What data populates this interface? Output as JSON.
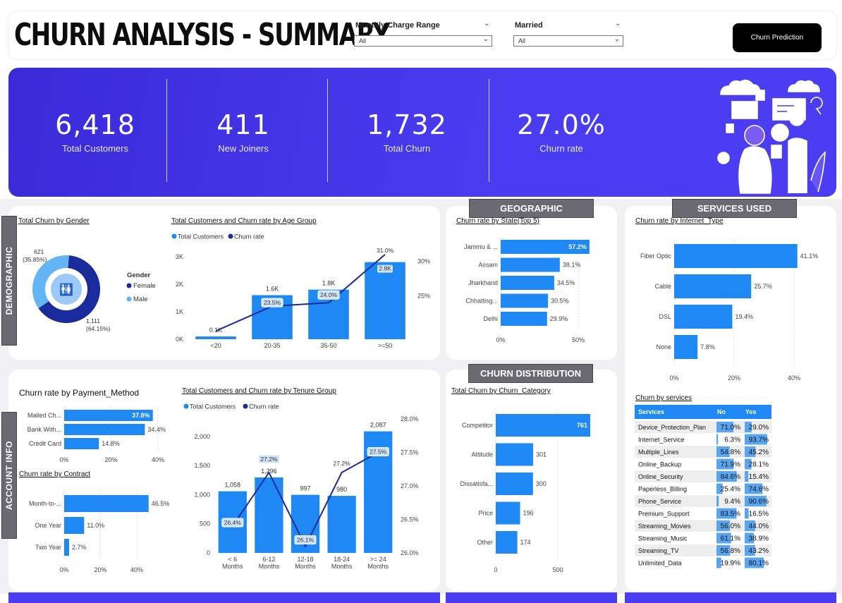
{
  "header": {
    "title": "CHURN ANALYSIS - SUMMARY",
    "slicers": [
      {
        "label": "Monthly Charge Range",
        "value": "All"
      },
      {
        "label": "Married",
        "value": "All"
      }
    ],
    "button": "Churn Prediction"
  },
  "kpis": [
    {
      "value": "6,418",
      "label": "Total Customers"
    },
    {
      "value": "411",
      "label": "New Joiners"
    },
    {
      "value": "1,732",
      "label": "Total Churn"
    },
    {
      "value": "27.0%",
      "label": "Churn rate"
    }
  ],
  "sections": {
    "demographic": "DEMOGRAPHIC",
    "account_info": "ACCOUNT INFO",
    "geographic": "GEOGRAPHIC",
    "services_used": "SERVICES USED",
    "churn_distribution": "CHURN DISTRIBUTION"
  },
  "colors": {
    "primary": "#1e88f5",
    "dark": "#1a2b9c",
    "light": "#64b5f6",
    "band": "#4a3cf0"
  },
  "chart_data": [
    {
      "id": "gender",
      "type": "pie",
      "title": "Total Churn by Gender",
      "legend_title": "Gender",
      "categories": [
        "Female",
        "Male"
      ],
      "values": [
        1111,
        621
      ],
      "labels": [
        "1,111",
        "621"
      ],
      "percent_labels": [
        "(64.15%)",
        "(35.85%)"
      ]
    },
    {
      "id": "age",
      "type": "bar",
      "title": "Total Customers and Churn rate by Age Group",
      "legend": [
        "Total Customers",
        "Churn rate"
      ],
      "categories": [
        "<20",
        "20-35",
        "35-50",
        ">=50"
      ],
      "series": [
        {
          "name": "Total Customers",
          "values": [
            100,
            1600,
            1800,
            2800
          ],
          "labels": [
            "0.1K",
            "1.6K",
            "1.8K",
            "2.8K"
          ]
        },
        {
          "name": "Churn rate",
          "values": [
            19.9,
            23.5,
            24.0,
            31.0
          ],
          "labels": [
            "",
            "23.5%",
            "24.0%",
            "31.0%"
          ]
        }
      ],
      "y_ticks": [
        "0K",
        "1K",
        "2K",
        "3K"
      ],
      "y2_ticks": [
        "25%",
        "30%"
      ]
    },
    {
      "id": "state",
      "type": "bar",
      "title": "Churn rate by State(Top 5)",
      "categories": [
        "Jammu & ...",
        "Assam",
        "Jharkhand",
        "Chhattisg...",
        "Delhi"
      ],
      "values": [
        57.2,
        38.1,
        34.5,
        30.5,
        29.9
      ],
      "labels": [
        "57.2%",
        "38.1%",
        "34.5%",
        "30.5%",
        "29.9%"
      ],
      "x_ticks": [
        "0%",
        "50%"
      ]
    },
    {
      "id": "internet",
      "type": "bar",
      "title": "Churn rate by Internet_Type",
      "categories": [
        "Fiber Optic",
        "Cable",
        "DSL",
        "None"
      ],
      "values": [
        41.1,
        25.7,
        19.4,
        7.8
      ],
      "labels": [
        "41.1%",
        "25.7%",
        "19.4%",
        "7.8%"
      ],
      "x_ticks": [
        "0%",
        "20%",
        "40%"
      ]
    },
    {
      "id": "payment",
      "type": "bar",
      "title": "Churn rate by Payment_Method",
      "categories": [
        "Mailed Ch...",
        "Bank With...",
        "Credit Card"
      ],
      "values": [
        37.8,
        34.4,
        14.8
      ],
      "labels": [
        "37.8%",
        "34.4%",
        "14.8%"
      ],
      "x_ticks": [
        "0%",
        "20%",
        "40%"
      ]
    },
    {
      "id": "contract",
      "type": "bar",
      "title": "Churn rate by Contract",
      "categories": [
        "Month-to-...",
        "One Year",
        "Two Year"
      ],
      "values": [
        46.5,
        11.0,
        2.7
      ],
      "labels": [
        "46.5%",
        "11.0%",
        "2.7%"
      ],
      "x_ticks": [
        "0%",
        "20%",
        "40%"
      ]
    },
    {
      "id": "tenure",
      "type": "bar",
      "title": "Total Customers and Churn rate by Tenure Group",
      "legend": [
        "Total Customers",
        "Churn rate"
      ],
      "categories": [
        "< 6|Months",
        "6-12|Months",
        "12-18|Months",
        "18-24|Months",
        ">= 24|Months"
      ],
      "series": [
        {
          "name": "Total Customers",
          "values": [
            1058,
            1296,
            997,
            980,
            2087
          ],
          "labels": [
            "1,058",
            "1,296",
            "997",
            "980",
            "2,087"
          ]
        },
        {
          "name": "Churn rate",
          "values": [
            26.4,
            27.2,
            26.1,
            27.2,
            27.5
          ],
          "labels": [
            "26.4%",
            "27.2%",
            "26.1%",
            "27.2%",
            "27.5%"
          ]
        }
      ],
      "y_ticks": [
        "0",
        "500",
        "1,000",
        "1,500",
        "2,000"
      ],
      "y2_ticks": [
        "26.0%",
        "26.5%",
        "27.0%",
        "27.5%",
        "28.0%"
      ]
    },
    {
      "id": "category",
      "type": "bar",
      "title": "Total Churn by Churn_Category",
      "categories": [
        "Competitor",
        "Attitude",
        "Dissatisfa...",
        "Price",
        "Other"
      ],
      "values": [
        761,
        301,
        300,
        196,
        174
      ],
      "labels": [
        "761",
        "301",
        "300",
        "196",
        "174"
      ],
      "x_ticks": [
        "0",
        "500"
      ]
    },
    {
      "id": "services",
      "type": "table",
      "title": "Churn by services",
      "columns": [
        "Services",
        "No",
        "Yes"
      ],
      "rows": [
        {
          "service": "Device_Protection_Plan",
          "no": "71.0%",
          "yes": "29.0%",
          "no_v": 71.0,
          "yes_v": 29.0
        },
        {
          "service": "Internet_Service",
          "no": "6.3%",
          "yes": "93.7%",
          "no_v": 6.3,
          "yes_v": 93.7
        },
        {
          "service": "Multiple_Lines",
          "no": "54.8%",
          "yes": "45.2%",
          "no_v": 54.8,
          "yes_v": 45.2
        },
        {
          "service": "Online_Backup",
          "no": "71.9%",
          "yes": "28.1%",
          "no_v": 71.9,
          "yes_v": 28.1
        },
        {
          "service": "Online_Security",
          "no": "84.6%",
          "yes": "15.4%",
          "no_v": 84.6,
          "yes_v": 15.4
        },
        {
          "service": "Paperless_Billing",
          "no": "25.4%",
          "yes": "74.6%",
          "no_v": 25.4,
          "yes_v": 74.6
        },
        {
          "service": "Phone_Service",
          "no": "9.4%",
          "yes": "90.6%",
          "no_v": 9.4,
          "yes_v": 90.6
        },
        {
          "service": "Premium_Support",
          "no": "83.5%",
          "yes": "16.5%",
          "no_v": 83.5,
          "yes_v": 16.5
        },
        {
          "service": "Streaming_Movies",
          "no": "56.0%",
          "yes": "44.0%",
          "no_v": 56.0,
          "yes_v": 44.0
        },
        {
          "service": "Streaming_Music",
          "no": "61.1%",
          "yes": "38.9%",
          "no_v": 61.1,
          "yes_v": 38.9
        },
        {
          "service": "Streaming_TV",
          "no": "56.8%",
          "yes": "43.2%",
          "no_v": 56.8,
          "yes_v": 43.2
        },
        {
          "service": "Unlimited_Data",
          "no": "19.9%",
          "yes": "80.1%",
          "no_v": 19.9,
          "yes_v": 80.1
        }
      ]
    }
  ]
}
